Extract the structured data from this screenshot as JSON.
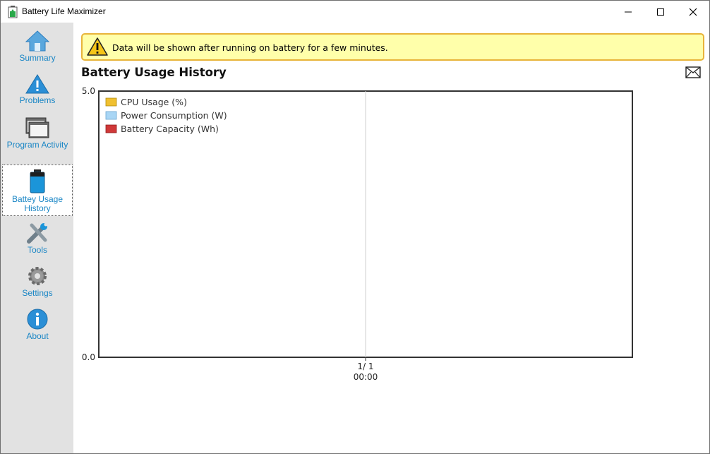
{
  "window": {
    "title": "Battery Life Maximizer"
  },
  "sidebar": {
    "items": [
      {
        "label": "Summary",
        "icon": "home-icon"
      },
      {
        "label": "Problems",
        "icon": "warning-icon"
      },
      {
        "label": "Program Activity",
        "icon": "windows-icon"
      },
      {
        "label": "Battey Usage History",
        "icon": "battery-icon",
        "active": true
      },
      {
        "label": "Tools",
        "icon": "tools-icon"
      },
      {
        "label": "Settings",
        "icon": "gear-icon"
      },
      {
        "label": "About",
        "icon": "info-icon"
      }
    ]
  },
  "banner": {
    "text": "Data will be shown after running on battery for a few minutes."
  },
  "main": {
    "title": "Battery Usage History"
  },
  "colors": {
    "accent": "#1a86c5",
    "cpu": "#f0c030",
    "power": "#a9d6f5",
    "capacity": "#d03838"
  },
  "chart_data": {
    "type": "line",
    "ylim": [
      0.0,
      5.0
    ],
    "y_ticks": [
      "5.0",
      "0.0"
    ],
    "x_ticks": [
      {
        "date": "1/ 1",
        "time": "00:00"
      }
    ],
    "legend": [
      "CPU Usage (%)",
      "Power Consumption (W)",
      "Battery Capacity (Wh)"
    ],
    "series": [
      {
        "name": "CPU Usage (%)",
        "values": []
      },
      {
        "name": "Power Consumption (W)",
        "values": []
      },
      {
        "name": "Battery Capacity (Wh)",
        "values": []
      }
    ],
    "grid": true
  }
}
